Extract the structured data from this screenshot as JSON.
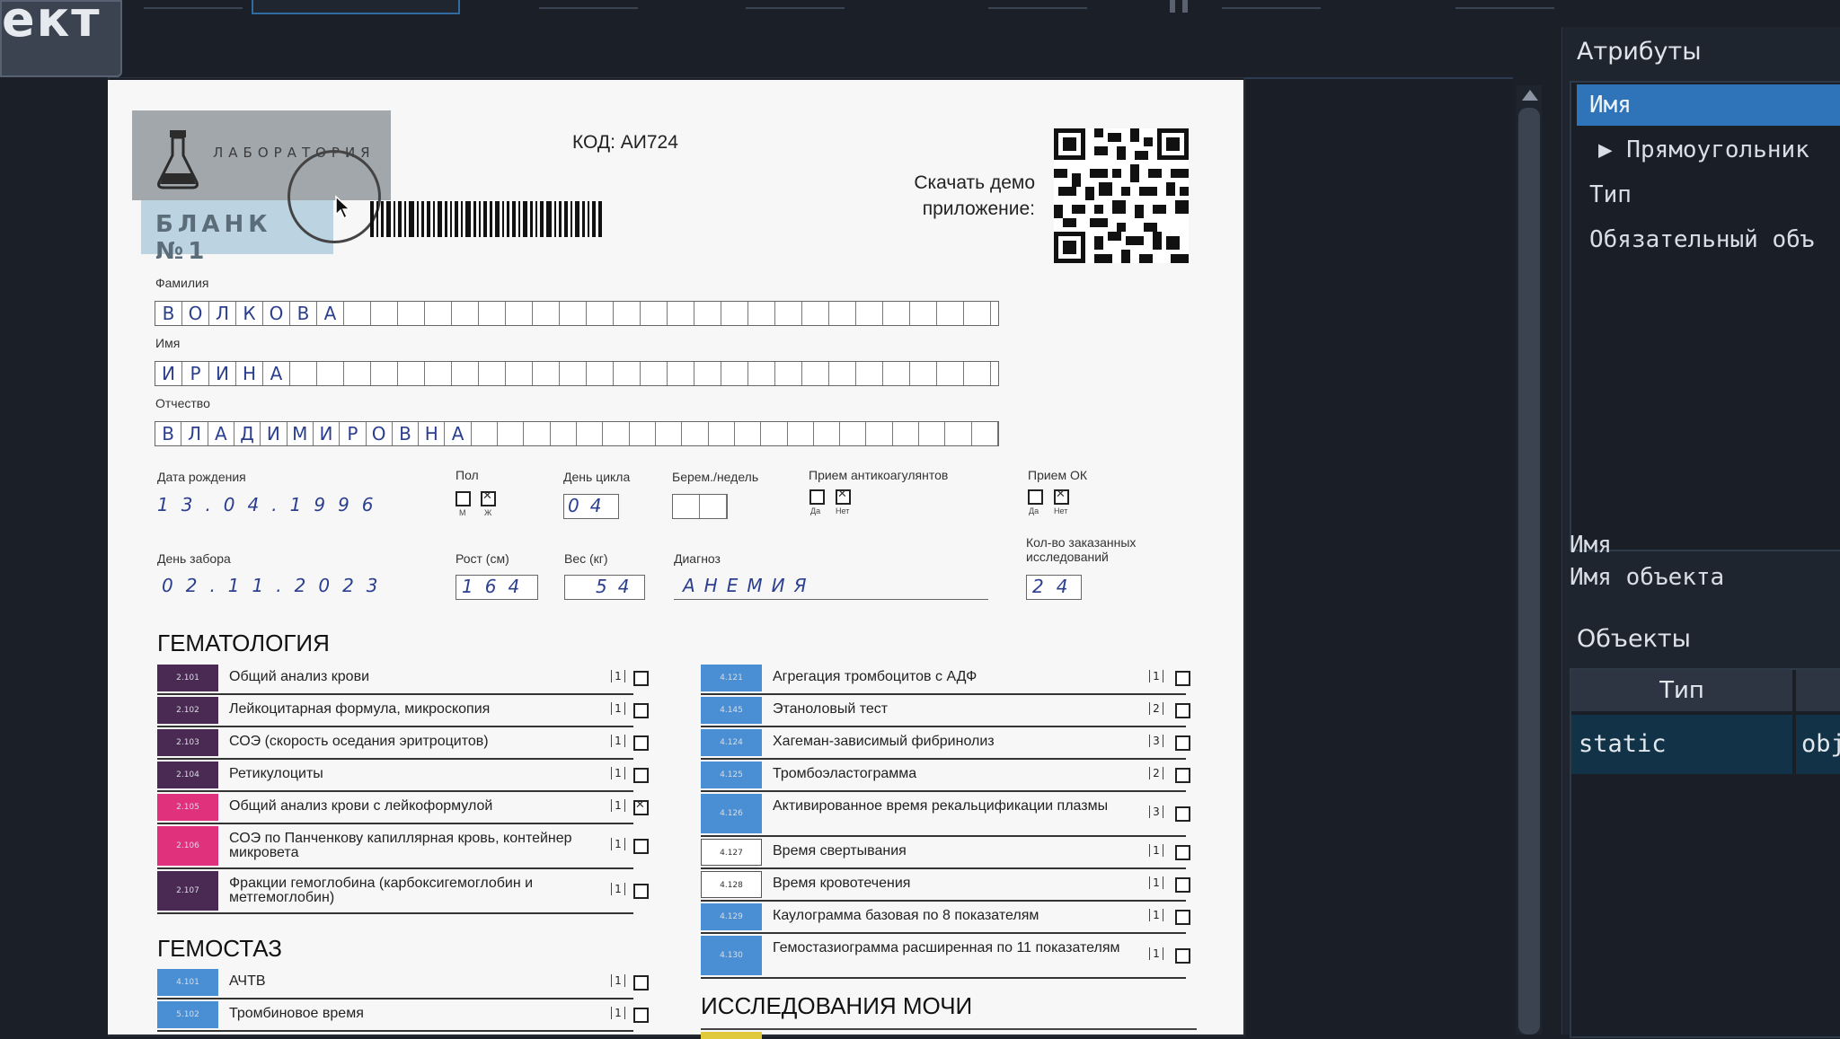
{
  "app": {
    "logo_partial": "ект"
  },
  "panel": {
    "title": "Атрибуты",
    "attributes": [
      {
        "label": "Имя"
      },
      {
        "label": "▶ Прямоугольник"
      },
      {
        "label": "Тип"
      },
      {
        "label": "Обязательный объ"
      }
    ],
    "name_label": "Имя",
    "name_value": "Имя объекта",
    "objects_title": "Объекты",
    "objects_header": "Тип",
    "objects_row_type": "static",
    "objects_row_value": "obj"
  },
  "form": {
    "lab_label": "ЛАБОРАТОРИЯ",
    "blank_label": "БЛАНК №1",
    "code": "КОД: АИ724",
    "download_text": "Скачать демо приложение:",
    "surname_label": "Фамилия",
    "surname": [
      "В",
      "О",
      "Л",
      "К",
      "О",
      "В",
      "А"
    ],
    "name_label": "Имя",
    "name": [
      "И",
      "Р",
      "И",
      "Н",
      "А"
    ],
    "patronymic_label": "Отчество",
    "patronymic": [
      "В",
      "Л",
      "А",
      "Д",
      "И",
      "М",
      "И",
      "Р",
      "О",
      "В",
      "Н",
      "А"
    ],
    "dob_label": "Дата рождения",
    "dob": "13.04.1996",
    "sex_label": "Пол",
    "sex_m": "М",
    "sex_f": "Ж",
    "cycle_label": "День цикла",
    "cycle": "04",
    "preg_label": "Берем./недель",
    "anticoag_label": "Прием антикоагулянтов",
    "yes": "Да",
    "no": "Нет",
    "ok_label": "Прием ОК",
    "collect_label": "День забора",
    "collect_date": "02.11.2023",
    "height_label": "Рост (см)",
    "height": "164",
    "weight_label": "Вес (кг)",
    "weight": "54",
    "diagnosis_label": "Диагноз",
    "diagnosis": "АНЕМИЯ",
    "count_label": "Кол-во заказанных исследований",
    "count": "24"
  },
  "sections": {
    "hematology": "ГЕМАТОЛОГИЯ",
    "hemostasis": "ГЕМОСТАЗ",
    "urine": "ИССЛЕДОВАНИЯ МОЧИ"
  },
  "hematology_tests": [
    {
      "code": "2.101",
      "name": "Общий анализ крови",
      "num": "1",
      "checked": false,
      "color": "#4a2a52"
    },
    {
      "code": "2.102",
      "name": "Лейкоцитарная формула, микроскопия",
      "num": "1",
      "checked": false,
      "color": "#4a2a52"
    },
    {
      "code": "2.103",
      "name": "СОЭ (скорость оседания эритроцитов)",
      "num": "1",
      "checked": false,
      "color": "#4a2a52"
    },
    {
      "code": "2.104",
      "name": "Ретикулоциты",
      "num": "1",
      "checked": false,
      "color": "#4a2a52"
    },
    {
      "code": "2.105",
      "name": "Общий анализ крови с лейкоформулой",
      "num": "1",
      "checked": true,
      "color": "#e0317d"
    },
    {
      "code": "2.106",
      "name": "СОЭ по Панченкову капиллярная кровь, контейнер микровета",
      "num": "1",
      "checked": false,
      "color": "#e0317d"
    },
    {
      "code": "2.107",
      "name": "Фракции гемоглобина (карбоксигемоглобин и метгемоглобин)",
      "num": "1",
      "checked": false,
      "color": "#4a2a52"
    }
  ],
  "hemostasis_tests": [
    {
      "code": "4.101",
      "name": "АЧТВ",
      "num": "1",
      "checked": false,
      "color": "#4a8fd4"
    },
    {
      "code": "5.102",
      "name": "Тромбиновое время",
      "num": "1",
      "checked": false,
      "color": "#4a8fd4"
    }
  ],
  "right_tests": [
    {
      "code": "4.121",
      "name": "Агрегация тромбоцитов с АДФ",
      "num": "1",
      "checked": false,
      "color": "#4a8fd4"
    },
    {
      "code": "4.145",
      "name": "Этаноловый тест",
      "num": "2",
      "checked": false,
      "color": "#4a8fd4"
    },
    {
      "code": "4.124",
      "name": "Хагеман-зависимый фибринолиз",
      "num": "3",
      "checked": false,
      "color": "#4a8fd4"
    },
    {
      "code": "4.125",
      "name": "Тромбоэластограмма",
      "num": "2",
      "checked": false,
      "color": "#4a8fd4"
    },
    {
      "code": "4.126",
      "name": "Активированное время рекальцификации плазмы",
      "num": "3",
      "checked": false,
      "color": "#4a8fd4"
    },
    {
      "code": "4.127",
      "name": "Время свертывания",
      "num": "1",
      "checked": false,
      "color": "#ffffff"
    },
    {
      "code": "4.128",
      "name": "Время кровотечения",
      "num": "1",
      "checked": false,
      "color": "#ffffff"
    },
    {
      "code": "4.129",
      "name": "Каулограмма базовая по 8 показателям",
      "num": "1",
      "checked": false,
      "color": "#4a8fd4"
    },
    {
      "code": "4.130",
      "name": "Гемостазиограмма расширенная по 11 показателям",
      "num": "1",
      "checked": false,
      "color": "#4a8fd4"
    }
  ],
  "icons": {
    "flask": "flask-icon",
    "cursor": "pointer-icon",
    "expand": "triangle-right-icon"
  }
}
